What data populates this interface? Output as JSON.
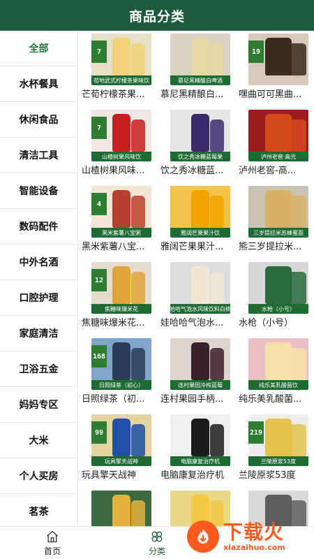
{
  "header": {
    "title": "商品分类"
  },
  "sidebar": {
    "items": [
      {
        "label": "全部",
        "active": true
      },
      {
        "label": "水杯餐具"
      },
      {
        "label": "休闲食品"
      },
      {
        "label": "清洁工具"
      },
      {
        "label": "智能设备"
      },
      {
        "label": "数码配件"
      },
      {
        "label": "中外名酒"
      },
      {
        "label": "口腔护理"
      },
      {
        "label": "家庭清洁"
      },
      {
        "label": "卫浴五金"
      },
      {
        "label": "妈妈专区"
      },
      {
        "label": "大米"
      },
      {
        "label": "个人买房"
      },
      {
        "label": "茗茶"
      }
    ]
  },
  "products": [
    {
      "title": "芒荀柠檬茶果...",
      "price": "7",
      "band": "苟地武式柠檬茶果味饮",
      "bg": "#e8dfc8",
      "color": "#f2d27a"
    },
    {
      "title": "慕尼黑精酿白...",
      "price": "",
      "band": "慕尼黑精酿白啤酒",
      "bg": "#d9d3c4",
      "color": "#e9d8a6"
    },
    {
      "title": "嘿曲可可黑曲...",
      "price": "19",
      "band": "",
      "bg": "#d7c9b7",
      "color": "#3a2a22"
    },
    {
      "title": "山楂树果风味...",
      "price": "7",
      "band": "山楂树果风味饮",
      "bg": "#f0e8e6",
      "color": "#c61f1f"
    },
    {
      "title": "饮之秀冰糖蓝...",
      "price": "",
      "band": "饮之秀冰糖蓝莓果",
      "bg": "#e6e6e6",
      "color": "#3a2b6b"
    },
    {
      "title": "泸州老窖-高...",
      "price": "",
      "band": "泸州老窖·高光",
      "bg": "#9b1e1e",
      "color": "#d34a1b"
    },
    {
      "title": "黑米紫薯八宝...",
      "price": "4",
      "band": "黑米紫薯八宝粥",
      "bg": "#f3e6d6",
      "color": "#b73f2b"
    },
    {
      "title": "雅阔芒果果汁...",
      "price": "",
      "band": "雅阔芒果果汁饮",
      "bg": "#f1c34a",
      "color": "#f4a400"
    },
    {
      "title": "熊三岁提拉米...",
      "price": "",
      "band": "三岁提拉米苏蜂蜜面",
      "bg": "#c9c3b2",
      "color": "#d8b26a"
    },
    {
      "title": "焦糖味爆米花...",
      "price": "12",
      "band": "焦糖味爆米花",
      "bg": "#e4ddcc",
      "color": "#e2a33a"
    },
    {
      "title": "娃哈哈气泡水...",
      "price": "",
      "band": "哈哈气泡水风味饮料白桃",
      "bg": "#dcdcdc",
      "color": "#f0e6d2"
    },
    {
      "title": "水枪（小号）",
      "price": "",
      "band": "水枪（小号）",
      "bg": "#d8d8d8",
      "color": "#2a6b3c"
    },
    {
      "title": "日照绿茶（初...",
      "price": "168",
      "band": "日照绿茶（初心）",
      "bg": "#7fa6c9",
      "color": "#2a3c5a"
    },
    {
      "title": "连村果园手柄...",
      "price": "",
      "band": "连村果园冷榨蓝莓",
      "bg": "#dcd6cf",
      "color": "#3b1f2b"
    },
    {
      "title": "纯乐美乳酸菌...",
      "price": "",
      "band": "纯乐美乳酸菌饮",
      "bg": "#eac0c6",
      "color": "#f7e1a8"
    },
    {
      "title": "玩具擎天战神",
      "price": "99",
      "band": "玩具擎天战神",
      "bg": "#e3d4a2",
      "color": "#1f4fa6"
    },
    {
      "title": "电脑康复治疗机",
      "price": "",
      "band": "电脑康复治疗机",
      "bg": "#efefef",
      "color": "#1b1b1b"
    },
    {
      "title": "兰陵原浆53度",
      "price": "219",
      "band": "兰陵原浆53度",
      "bg": "#eeeeee",
      "color": "#e3c34c"
    },
    {
      "title": "",
      "price": "",
      "band": "",
      "bg": "#3a6b3f",
      "color": "#e1b23f"
    },
    {
      "title": "",
      "price": "",
      "band": "",
      "bg": "#e9d88a",
      "color": "#f2c845"
    },
    {
      "title": "",
      "price": "",
      "band": "",
      "bg": "#d9d9d9",
      "color": "#5e5e5e"
    }
  ],
  "tabbar": {
    "items": [
      {
        "label": "首页",
        "icon": "home-icon"
      },
      {
        "label": "分类",
        "icon": "clover-icon",
        "active": true
      },
      {
        "label": "",
        "icon": ""
      }
    ]
  },
  "watermark": {
    "cn": "下载火",
    "en": "xiazaihuo.com"
  }
}
